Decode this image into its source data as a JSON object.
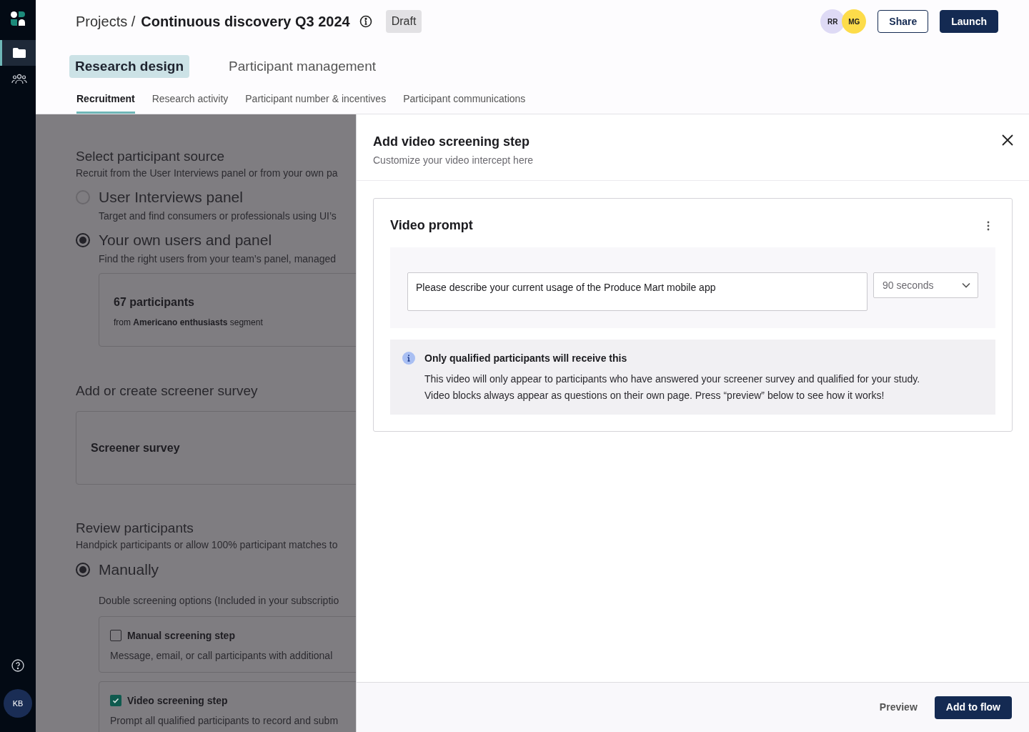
{
  "sidebar": {
    "nav": [
      {
        "kind": "projects",
        "selected": true
      },
      {
        "kind": "participants",
        "selected": false
      }
    ],
    "user_initials": "KB"
  },
  "header": {
    "breadcrumb": "Projects /",
    "title": "Continuous discovery Q3 2024",
    "status": "Draft",
    "collaborators": [
      {
        "initials": "RR",
        "color": "#dedaf5"
      },
      {
        "initials": "MG",
        "color": "#fddc4a"
      }
    ],
    "actions": [
      {
        "label": "Share",
        "kind": "secondary"
      },
      {
        "label": "Launch",
        "kind": "primary"
      }
    ]
  },
  "main_tabs": [
    {
      "label": "Research design",
      "selected": true
    },
    {
      "label": "Participant management",
      "selected": false
    }
  ],
  "sub_tabs": [
    {
      "label": "Recruitment",
      "selected": true
    },
    {
      "label": "Research activity",
      "selected": false
    },
    {
      "label": "Participant number & incentives",
      "selected": false
    },
    {
      "label": "Participant communications",
      "selected": false
    }
  ],
  "source": {
    "title": "Select participant source",
    "description": "Recruit from the User Interviews panel or from your own pa",
    "options": [
      {
        "label": "User Interviews panel",
        "description": "Target and find consumers or professionals using UI’s",
        "selected": false
      },
      {
        "label": "Your own users and panel",
        "description": "Find the right users from your team’s panel, managed",
        "selected": true
      }
    ],
    "segment": {
      "count": "67 participants",
      "detail": "from **Americano enthusiasts** segment"
    }
  },
  "screener": {
    "title": "Add or create screener survey",
    "card": "Screener survey"
  },
  "review": {
    "title": "Review participants",
    "description": "Handpick participants or allow 100% participant matches to",
    "options": [
      {
        "label": "Manually",
        "selected": true
      }
    ],
    "double_screening_label": "Double screening options (Included in your subscriptio",
    "steps": [
      {
        "title": "Manual screening step",
        "description": "Message, email, or call participants with additional",
        "checked": false
      },
      {
        "title": "Video screening step",
        "description": "Prompt all qualified participants to record and subm",
        "checked": true
      }
    ]
  },
  "drawer": {
    "title": "Add video screening step",
    "subtitle": "Customize your video intercept here",
    "prompt_card": {
      "title": "Video prompt",
      "prompt": "Please describe your current usage of the Produce Mart mobile app",
      "duration": "90 seconds",
      "notice_title": "Only qualified participants will receive this",
      "notice_lines": [
        "This video will only appear to participants who have answered your screener survey and qualified for your study.",
        "Video blocks always appear as questions on their own page. Press “preview” below to see how it works!"
      ]
    },
    "footer_actions": [
      {
        "label": "Preview",
        "kind": "secondary"
      },
      {
        "label": "Add to flow",
        "kind": "primary"
      }
    ]
  }
}
